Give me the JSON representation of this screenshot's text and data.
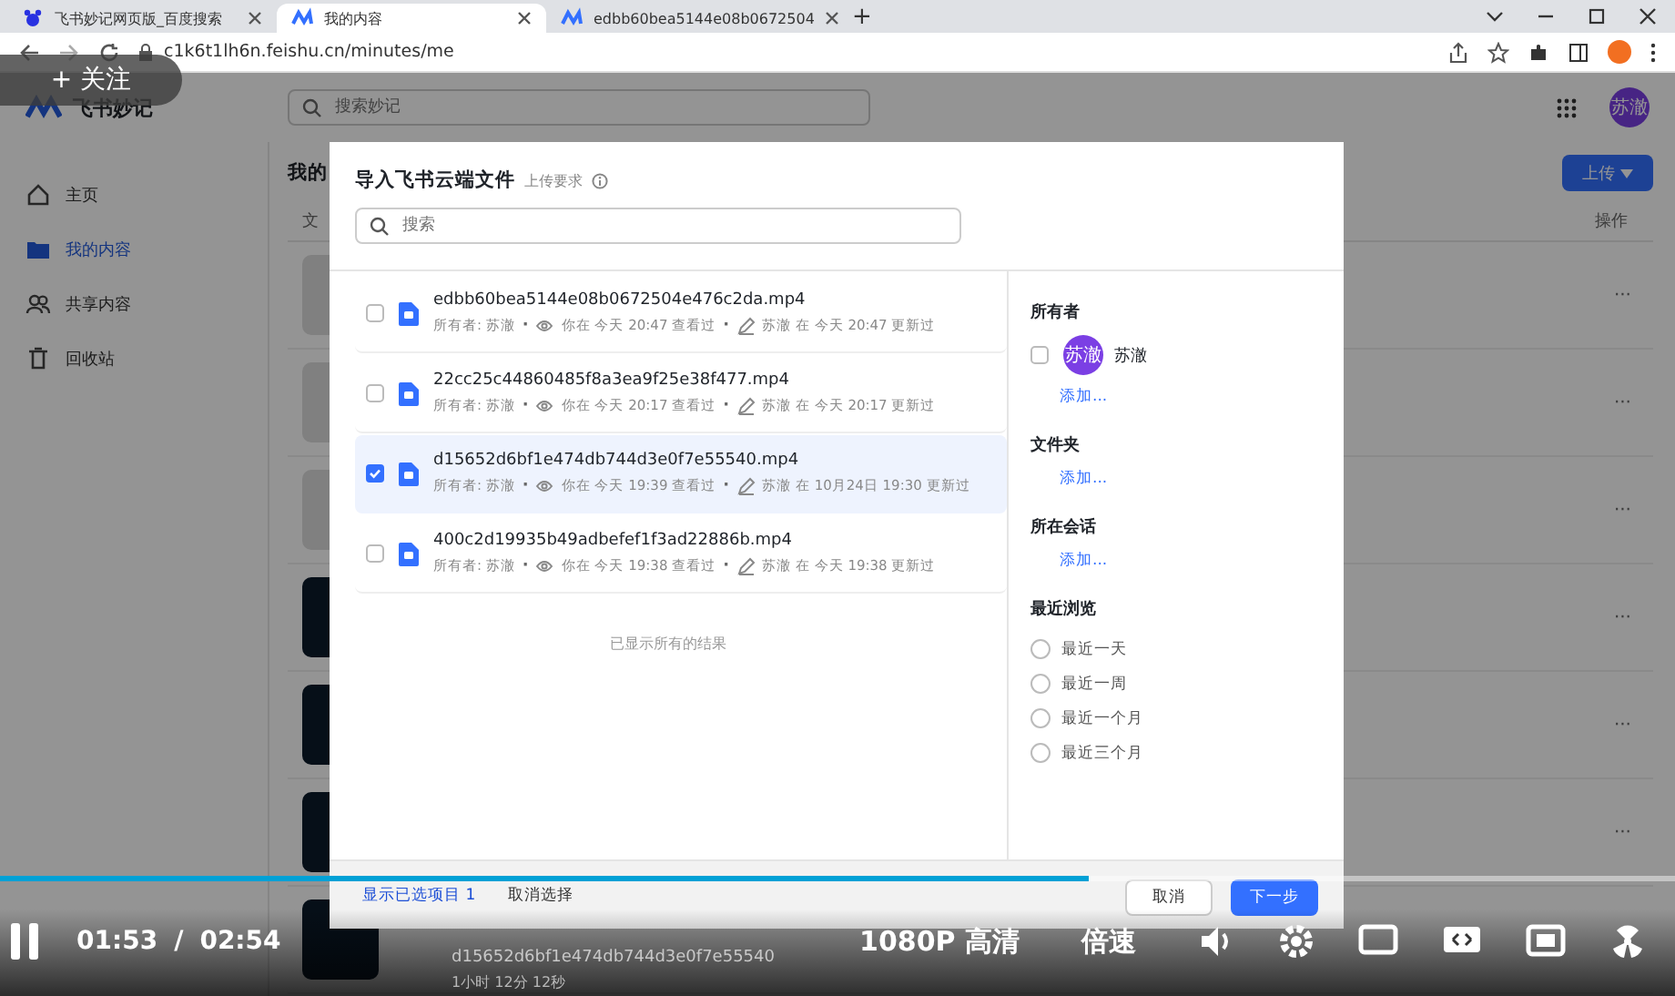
{
  "browser": {
    "tabs": [
      {
        "title": "飞书妙记网页版_百度搜索",
        "kind": "baidu",
        "selected": false
      },
      {
        "title": "我的内容",
        "kind": "feishu",
        "selected": true
      },
      {
        "title": "edbb60bea5144e08b0672504",
        "kind": "feishu",
        "selected": false
      }
    ],
    "new_tab": "+",
    "address": "c1k6t1lh6n.feishu.cn/minutes/me"
  },
  "app": {
    "logo": "飞书妙记",
    "search": {
      "placeholder": "搜索妙记"
    },
    "avatar": "苏澈",
    "sidebar": {
      "items": [
        {
          "label": "主页",
          "kind": "home",
          "selected": false
        },
        {
          "label": "我的内容",
          "kind": "folder",
          "selected": true
        },
        {
          "label": "共享内容",
          "kind": "people",
          "selected": false
        },
        {
          "label": "回收站",
          "kind": "trash",
          "selected": false
        }
      ]
    },
    "page_title": "我的",
    "column_1": "文",
    "upload_button": "上传",
    "actions_header": "操作",
    "rows": [
      {
        "kind": "light",
        "more": "···"
      },
      {
        "kind": "light",
        "more": "···"
      },
      {
        "kind": "light",
        "more": "···"
      },
      {
        "kind": "dark",
        "more": "···"
      },
      {
        "kind": "dark",
        "more": "···"
      },
      {
        "kind": "dark",
        "more": "···"
      },
      {
        "kind": "dark",
        "name": "d15652d6bf1e474db744d3e0f7e55540",
        "duration": "1小时 12分 12秒"
      }
    ]
  },
  "dialog": {
    "title": "导入飞书云端文件",
    "hint": "上传要求",
    "search": {
      "placeholder": "搜索"
    },
    "files": [
      {
        "name": "edbb60bea5144e08b0672504e476c2da.mp4",
        "owner": "所有者: 苏澈",
        "viewed": "你在 今天 20:47 查看过",
        "updated": "苏澈 在 今天 20:47 更新过",
        "selected": false
      },
      {
        "name": "22cc25c44860485f8a3ea9f25e38f477.mp4",
        "owner": "所有者: 苏澈",
        "viewed": "你在 今天 20:17 查看过",
        "updated": "苏澈 在 今天 20:17 更新过",
        "selected": false
      },
      {
        "name": "d15652d6bf1e474db744d3e0f7e55540.mp4",
        "owner": "所有者: 苏澈",
        "viewed": "你在 今天 19:39 查看过",
        "updated": "苏澈 在 10月24日 19:30 更新过",
        "selected": true
      },
      {
        "name": "400c2d19935b49adbefef1f3ad22886b.mp4",
        "owner": "所有者: 苏澈",
        "viewed": "你在 今天 19:38 查看过",
        "updated": "苏澈 在 今天 19:38 更新过",
        "selected": false
      }
    ],
    "meta_separator": "·",
    "end_note": "已显示所有的结果",
    "filters": {
      "owner_title": "所有者",
      "owner": {
        "avatar": "苏澈",
        "name": "苏澈",
        "checked": false
      },
      "owner_add": "添加...",
      "folder_title": "文件夹",
      "folder_add": "添加...",
      "chat_title": "所在会话",
      "chat_add": "添加...",
      "recent_title": "最近浏览",
      "recent": [
        {
          "label": "最近一天",
          "selected": false
        },
        {
          "label": "最近一周",
          "selected": false
        },
        {
          "label": "最近一个月",
          "selected": false
        },
        {
          "label": "最近三个月",
          "selected": false
        }
      ]
    },
    "footer": {
      "show_selected": "显示已选项目 1",
      "clear": "取消选择",
      "cancel": "取消",
      "next": "下一步"
    }
  },
  "player": {
    "follow": "+ 关注",
    "level": 0.65,
    "time": "01:53",
    "separator": "/",
    "duration": "02:54",
    "quality": "1080P 高清",
    "speed": "倍速"
  }
}
